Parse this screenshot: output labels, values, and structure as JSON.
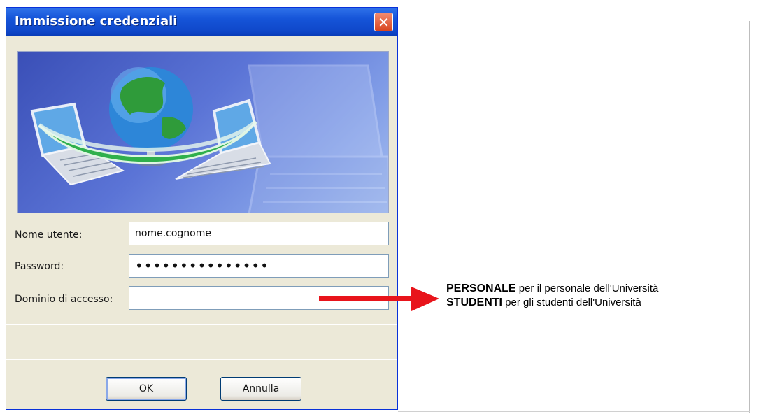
{
  "dialog": {
    "title": "Immissione credenziali",
    "close_icon": "close-icon"
  },
  "form": {
    "username_label": "Nome utente:",
    "username_value": "nome.cognome",
    "password_label": "Password:",
    "password_value": "•••••••••••••••",
    "domain_label": "Dominio di accesso:",
    "domain_value": ""
  },
  "buttons": {
    "ok": "OK",
    "cancel": "Annulla"
  },
  "annotation": {
    "line1_bold": "PERSONALE",
    "line1_rest": " per il personale dell'Università",
    "line2_bold": "STUDENTI",
    "line2_rest": " per gli studenti dell'Università",
    "arrow_color": "#e8141b"
  },
  "colors": {
    "titlebar": "#1554d8",
    "dialog_bg": "#ece9d8",
    "close_button": "#d9451f"
  }
}
